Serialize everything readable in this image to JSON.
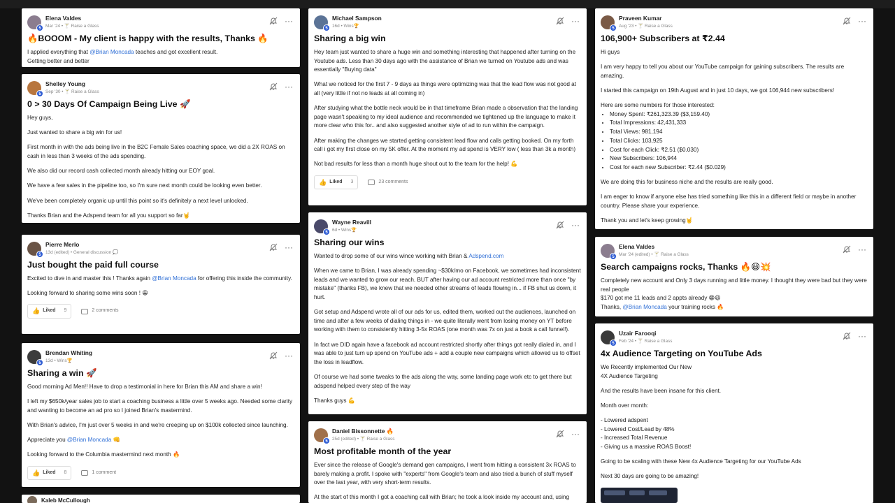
{
  "colors": {
    "background": "#121212",
    "card": "#ffffff",
    "mention": "#2f6fd6",
    "level_badge": "#2d5bd3"
  },
  "posts": {
    "elena1": {
      "author": "Elena Valdes",
      "meta": "Mar '24 • 🍸 Raise a Glass",
      "level": "5",
      "title": "🔥BOOOM - My client is happy with the results, Thanks 🔥",
      "p1a": "I applied everything that ",
      "mention": "@Brian Moncada",
      "p1b": " teaches and got excellent result.",
      "p2": "Getting better and better"
    },
    "shelley": {
      "author": "Shelley Young",
      "meta": "Sep '30 • 🍸 Raise a Glass",
      "level": "5",
      "title": "0 > 30 Days Of Campaign Being Live 🚀",
      "p1": "Hey guys,",
      "p2": "Just wanted to share a big win for us!",
      "p3": "First month in with the ads being live in the B2C Female Sales coaching space, we did a 2X ROAS on cash in less than 3 weeks of the ads spending.",
      "p4": "We also did our record cash collected month already hitting our EOY goal.",
      "p5": "We have a few sales in the pipeline too, so I'm sure next month could be looking even better.",
      "p6": "We've been completely organic up until this point so it's definitely a next level unlocked.",
      "p7": "Thanks Brian and the Adspend team for all you support so far🤘"
    },
    "pierre": {
      "author": "Pierre Merlo",
      "meta": "13d (edited) • General discussion 💭",
      "level": "5",
      "title": "Just bought the paid full course",
      "p1a": "Excited to dive in and master this ! Thanks again ",
      "mention": "@Brian Moncada",
      "p1b": " for offering this inside the community.",
      "p2": "Looking forward to sharing some wins soon ! 😀",
      "liked": "Liked",
      "likes": "9",
      "comments": "2 comments"
    },
    "brendan": {
      "author": "Brendan Whiting",
      "meta": "13d • Wins🏆",
      "level": "5",
      "title": "Sharing a win 🚀",
      "p1": "Good morning Ad Men!! Have to drop a testimonial in here for Brian this AM and share a win!",
      "p2": "I left my $650k/year sales job to start a coaching business a little over 5 weeks ago. Needed some clarity and wanting to become an ad pro so I joined Brian's mastermind.",
      "p3": "With Brian's advice, I'm just over 5 weeks in and we're creeping up on $100k collected since launching.",
      "p4a": "Appreciate you ",
      "mention": "@Brian Moncada",
      "p4b": " 👊",
      "p5": "Looking forward to the Columbia mastermind next month 🔥",
      "liked": "Liked",
      "likes": "8",
      "comments": "1 comment"
    },
    "kaleb": {
      "author": "Kaleb McCullough"
    },
    "michael": {
      "author": "Michael Sampson",
      "meta": "16d • Wins🏆",
      "level": "5",
      "title": "Sharing a big win",
      "p1": "Hey team just wanted to share a huge win and something interesting that happened after turning on the Youtube ads. Less than 30 days ago with the assistance of Brian we turned on Youtube ads and was essentially \"Buying data\"",
      "p2": "What we noticed for the first 7 - 9 days as things were optimizing was that the lead flow was not good at all (very little if not no leads at all coming in)",
      "p3": "After studying what the bottle neck would be in that timeframe Brian made a observation that the landing page wasn't speaking to my ideal audience and recommended we tightened up the language to make it more clear who this for.. and also suggested another style of ad to run within the campaign.",
      "p4": "After making the changes we started getting consistent lead flow and calls getting booked. On my forth call i got my first close on my 5K offer. At the moment my ad spend is VERY low ( less than 3k a month)",
      "p5": "Not bad results for less than a month huge shout out to the team for the help! 💪",
      "liked": "Liked",
      "likes": "3",
      "comments": "23 comments"
    },
    "wayne": {
      "author": "Wayne Reavill",
      "meta": "6d • Wins🏆",
      "level": "5",
      "title": "Sharing our wins",
      "p1a": "Wanted to drop some of our wins wince working with Brian & ",
      "link": "Adspend.com",
      "p2": "When we came to Brian, I was already spending ~$30k/mo on Facebook, we sometimes had inconsistent leads and we wanted to grow our reach. BUT after having our ad account restricted more than once \"by mistake\" (thanks FB), we knew that we needed other streams of leads flowing in... if FB shut us down, it hurt.",
      "p3": "Got setup and Adspend wrote all of our ads for us, edited them, worked out the audiences, launched on time and after a few weeks of dialing things in - we quite literally went from losing money on YT before working with them to consistently hitting 3-5x ROAS (one month was 7x on just a book a call funnel!).",
      "p4": "In fact we DID again have a facebook ad account restricted shortly after things got really dialed in, and I was able to just turn up spend on YouTube ads + add a couple new campaigns which allowed us to offset the loss in leadflow.",
      "p5": "Of course we had some tweaks to the ads along the way, some landing page work etc to get there but adspend helped every step of the way",
      "p6": "Thanks guys 💪"
    },
    "daniel": {
      "author": "Daniel Bissonnette 🔥",
      "meta": "25d (edited) • 🍸 Raise a Glass",
      "level": "5",
      "title": "Most profitable month of the year",
      "p1": "Ever since the release of Google's demand gen campaigns, I went from hitting a consistent 3x ROAS to barely making a profit. I spoke with \"experts\" from Google's team and also tried a bunch of stuff myself over the last year, with very short-term results.",
      "p2": "At the start of this month I got a coaching call with Brian; he took a look inside my account and, using"
    },
    "praveen": {
      "author": "Praveen Kumar",
      "meta": "Aug '23 • 🍸 Raise a Glass",
      "level": "5",
      "title": "106,900+ Subscribers at ₹2.44",
      "p1": "Hi guys",
      "p2": "I am very happy to tell you about our YouTube campaign for gaining subscribers. The results are amazing.",
      "p3": "I started this campaign on 19th August and in just 10 days, we got 106,944 new subscribers!",
      "p4": "Here are some numbers for those interested:",
      "stats": [
        "Money Spent: ₹261,323.39 ($3,159.40)",
        "Total Impressions: 42,431,333",
        "Total Views: 981,194",
        "Total Clicks: 103,925",
        "Cost for each Click: ₹2.51 ($0.030)",
        "New Subscribers: 106,944",
        "Cost for each new Subscriber: ₹2.44 ($0.029)"
      ],
      "p5": "We are doing this for business niche and the results are really good.",
      "p6": "I am eager to know if anyone else has tried something like this in a different field or maybe in another country. Please share your experience.",
      "p7": "Thank you and let's keep growing🤘"
    },
    "elena2": {
      "author": "Elena Valdes",
      "meta": "Mar '24 (edited) • 🍸 Raise a Glass",
      "level": "5",
      "title": "Search campaigns rocks, Thanks 🔥😄💥",
      "p1": "Completely new account and Only 3 days running and little money. I thought they were bad but they were real people",
      "p2": "$170 got me 11 leads and 2 appts already 😁😃",
      "p3a": "Thanks, ",
      "mention": "@Brian Moncada",
      "p3b": " your training rocks 🔥"
    },
    "uzair": {
      "author": "Uzair Farooqi",
      "meta": "Feb '24 • 🍸 Raise a Glass",
      "level": "5",
      "title": "4x Audience Targeting on YouTube Ads",
      "p1a": "We Recently implemented Our New",
      "p1b": "4X Audience Targeting",
      "p2": "And the results have been insane for this client.",
      "p3": "Month over month:",
      "items": [
        "- Lowered adspent",
        "- Lowered Cost/Lead by 48%",
        "- Increased Total Revenue",
        "- Giving us a massive ROAS Boost!"
      ],
      "p4": "Going to be scaling with these New 4x Audience Targeting for our YouTube Ads",
      "p5": "Next 30 days are going to be amazing!"
    }
  }
}
